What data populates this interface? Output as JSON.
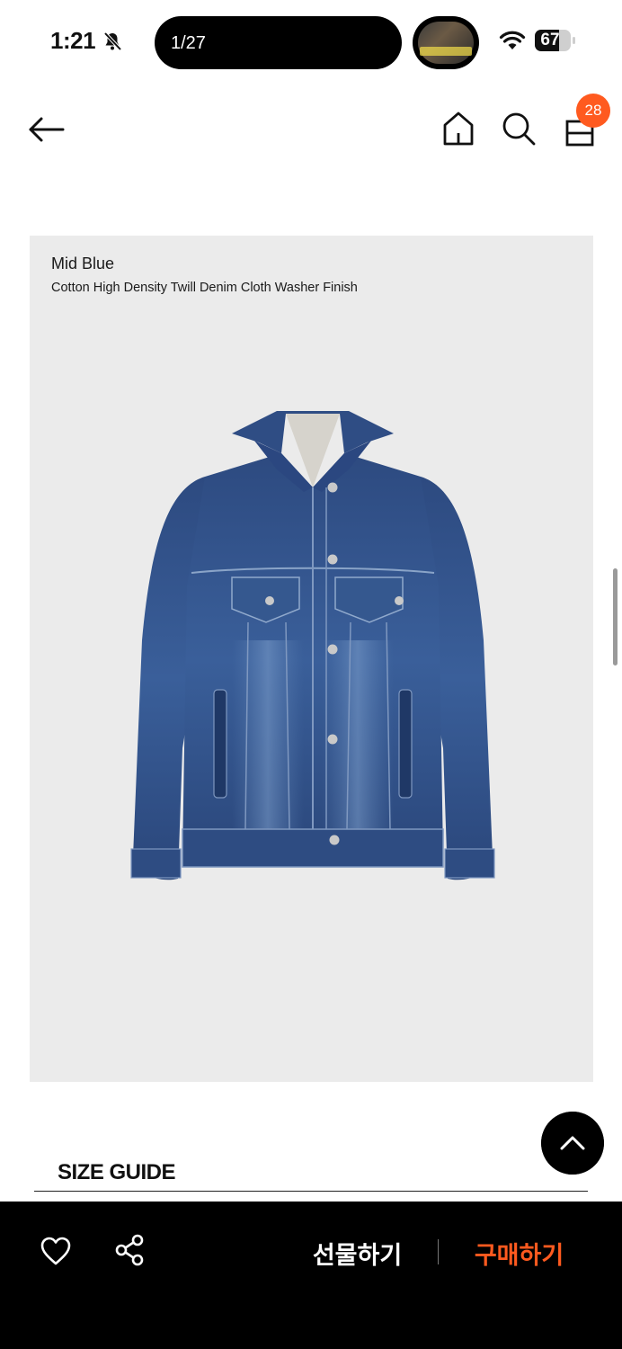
{
  "status_bar": {
    "time": "1:21",
    "island_counter": "1/27",
    "battery_percent": "67",
    "battery_level": 0.67
  },
  "header": {
    "cart_count": "28",
    "icons": [
      "back-arrow-icon",
      "home-icon",
      "search-icon",
      "shopping-bag-icon"
    ]
  },
  "product": {
    "color_name": "Mid Blue",
    "fabric_description": "Cotton High Density Twill Denim Cloth Washer Finish",
    "image_bg": "#ebebeb",
    "denim_color": "#2f4f86"
  },
  "size_guide": {
    "title": "SIZE GUIDE"
  },
  "bottom_bar": {
    "gift_label": "선물하기",
    "buy_label": "구매하기",
    "accent": "#ff5a1f"
  }
}
